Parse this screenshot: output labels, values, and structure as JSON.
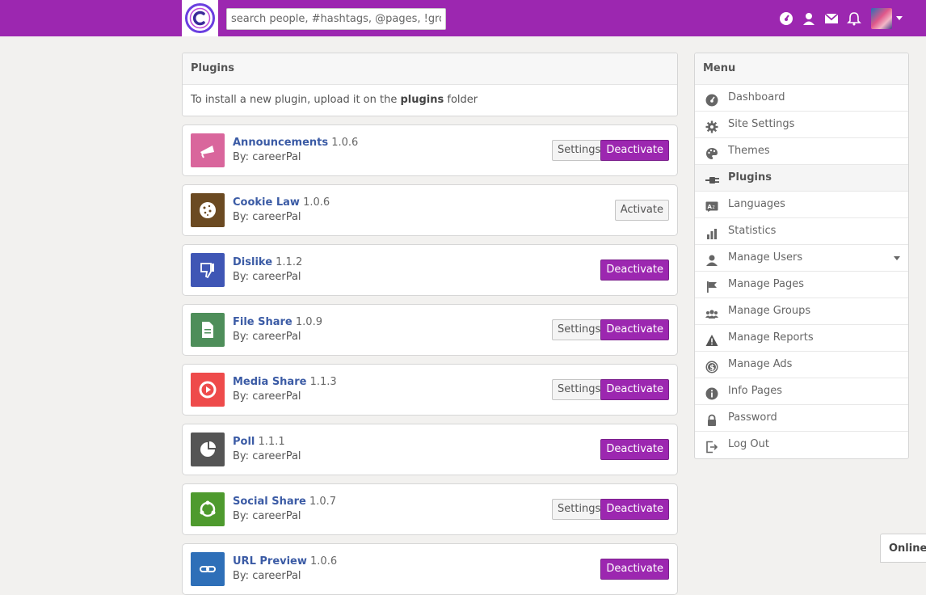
{
  "search": {
    "placeholder": "search people, #hashtags, @pages, !groups"
  },
  "topbar": {
    "icons": [
      "dashboard-icon",
      "friends-icon",
      "messages-icon",
      "notifications-icon"
    ]
  },
  "intro": {
    "title": "Plugins",
    "text_before": "To install a new plugin, upload it on the ",
    "text_bold": "plugins",
    "text_after": " folder"
  },
  "plugins": [
    {
      "name": "Announcements",
      "version": "1.0.6",
      "by_label": "By:",
      "author": "careerPal",
      "settings": "Settings",
      "action": "Deactivate",
      "color": "#d9669c",
      "icon": "megaphone-icon"
    },
    {
      "name": "Cookie Law",
      "version": "1.0.6",
      "by_label": "By:",
      "author": "careerPal",
      "action": "Activate",
      "color": "#6b4a22",
      "icon": "cookie-icon"
    },
    {
      "name": "Dislike",
      "version": "1.1.2",
      "by_label": "By:",
      "author": "careerPal",
      "action": "Deactivate",
      "color": "#3f56b5",
      "icon": "thumbs-down-icon"
    },
    {
      "name": "File Share",
      "version": "1.0.9",
      "by_label": "By:",
      "author": "careerPal",
      "settings": "Settings",
      "action": "Deactivate",
      "color": "#4e8e5a",
      "icon": "file-icon"
    },
    {
      "name": "Media Share",
      "version": "1.1.3",
      "by_label": "By:",
      "author": "careerPal",
      "settings": "Settings",
      "action": "Deactivate",
      "color": "#ee4b4b",
      "icon": "play-icon"
    },
    {
      "name": "Poll",
      "version": "1.1.1",
      "by_label": "By:",
      "author": "careerPal",
      "action": "Deactivate",
      "color": "#555555",
      "icon": "pie-icon"
    },
    {
      "name": "Social Share",
      "version": "1.0.7",
      "by_label": "By:",
      "author": "careerPal",
      "settings": "Settings",
      "action": "Deactivate",
      "color": "#4e9a2e",
      "icon": "share-icon"
    },
    {
      "name": "URL Preview",
      "version": "1.0.6",
      "by_label": "By:",
      "author": "careerPal",
      "action": "Deactivate",
      "color": "#2e6fb8",
      "icon": "link-icon"
    }
  ],
  "menu": {
    "title": "Menu",
    "items": [
      {
        "label": "Dashboard",
        "icon": "dashboard-icon"
      },
      {
        "label": "Site Settings",
        "icon": "gear-icon"
      },
      {
        "label": "Themes",
        "icon": "palette-icon"
      },
      {
        "label": "Plugins",
        "icon": "plug-icon",
        "active": true
      },
      {
        "label": "Languages",
        "icon": "language-icon"
      },
      {
        "label": "Statistics",
        "icon": "bar-chart-icon"
      },
      {
        "label": "Manage Users",
        "icon": "users-icon",
        "expandable": true
      },
      {
        "label": "Manage Pages",
        "icon": "flag-icon"
      },
      {
        "label": "Manage Groups",
        "icon": "group-icon"
      },
      {
        "label": "Manage Reports",
        "icon": "warning-icon"
      },
      {
        "label": "Manage Ads",
        "icon": "dollar-icon"
      },
      {
        "label": "Info Pages",
        "icon": "info-icon"
      },
      {
        "label": "Password",
        "icon": "lock-icon"
      },
      {
        "label": "Log Out",
        "icon": "logout-icon"
      }
    ]
  },
  "chat": {
    "status": "Online"
  },
  "colors": {
    "brand": "#9c27b0",
    "link": "#3b5ba5"
  }
}
